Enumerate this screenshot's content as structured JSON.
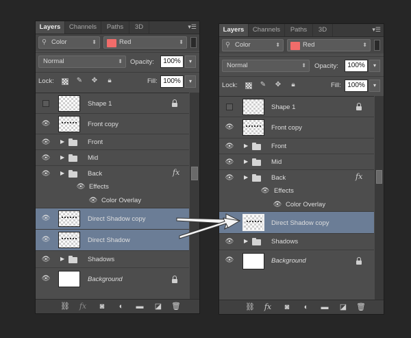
{
  "tabs": [
    "Layers",
    "Channels",
    "Paths",
    "3D"
  ],
  "filter": {
    "kind": "Color",
    "color_label": "Red"
  },
  "blend_mode": "Normal",
  "opacity_label": "Opacity:",
  "opacity_value": "100%",
  "lock_label": "Lock:",
  "fill_label": "Fill:",
  "fill_value": "100%",
  "left_layers": [
    {
      "name": "Shape 1"
    },
    {
      "name": "Front copy"
    },
    {
      "name": "Front"
    },
    {
      "name": "Mid"
    },
    {
      "name": "Back"
    },
    {
      "name": "Effects"
    },
    {
      "name": "Color Overlay"
    },
    {
      "name": "Direct Shadow copy"
    },
    {
      "name": "Direct Shadow"
    },
    {
      "name": "Shadows"
    },
    {
      "name": "Background"
    }
  ],
  "right_layers": [
    {
      "name": "Shape 1"
    },
    {
      "name": "Front copy"
    },
    {
      "name": "Front"
    },
    {
      "name": "Mid"
    },
    {
      "name": "Back"
    },
    {
      "name": "Effects"
    },
    {
      "name": "Color Overlay"
    },
    {
      "name": "Direct Shadow copy"
    },
    {
      "name": "Shadows"
    },
    {
      "name": "Background"
    }
  ],
  "fx_label": "fx",
  "icons": [
    "eye-icon",
    "lock-icon",
    "folder-icon",
    "link-icon",
    "fx-icon",
    "mask-icon",
    "adjustment-icon",
    "new-group-icon",
    "new-layer-icon",
    "trash-icon",
    "arrow-icon"
  ],
  "colors": {
    "panel_bg": "#4d4d4d",
    "selected_row": "#6b7d96",
    "filter_swatch": "#f16c6a"
  }
}
